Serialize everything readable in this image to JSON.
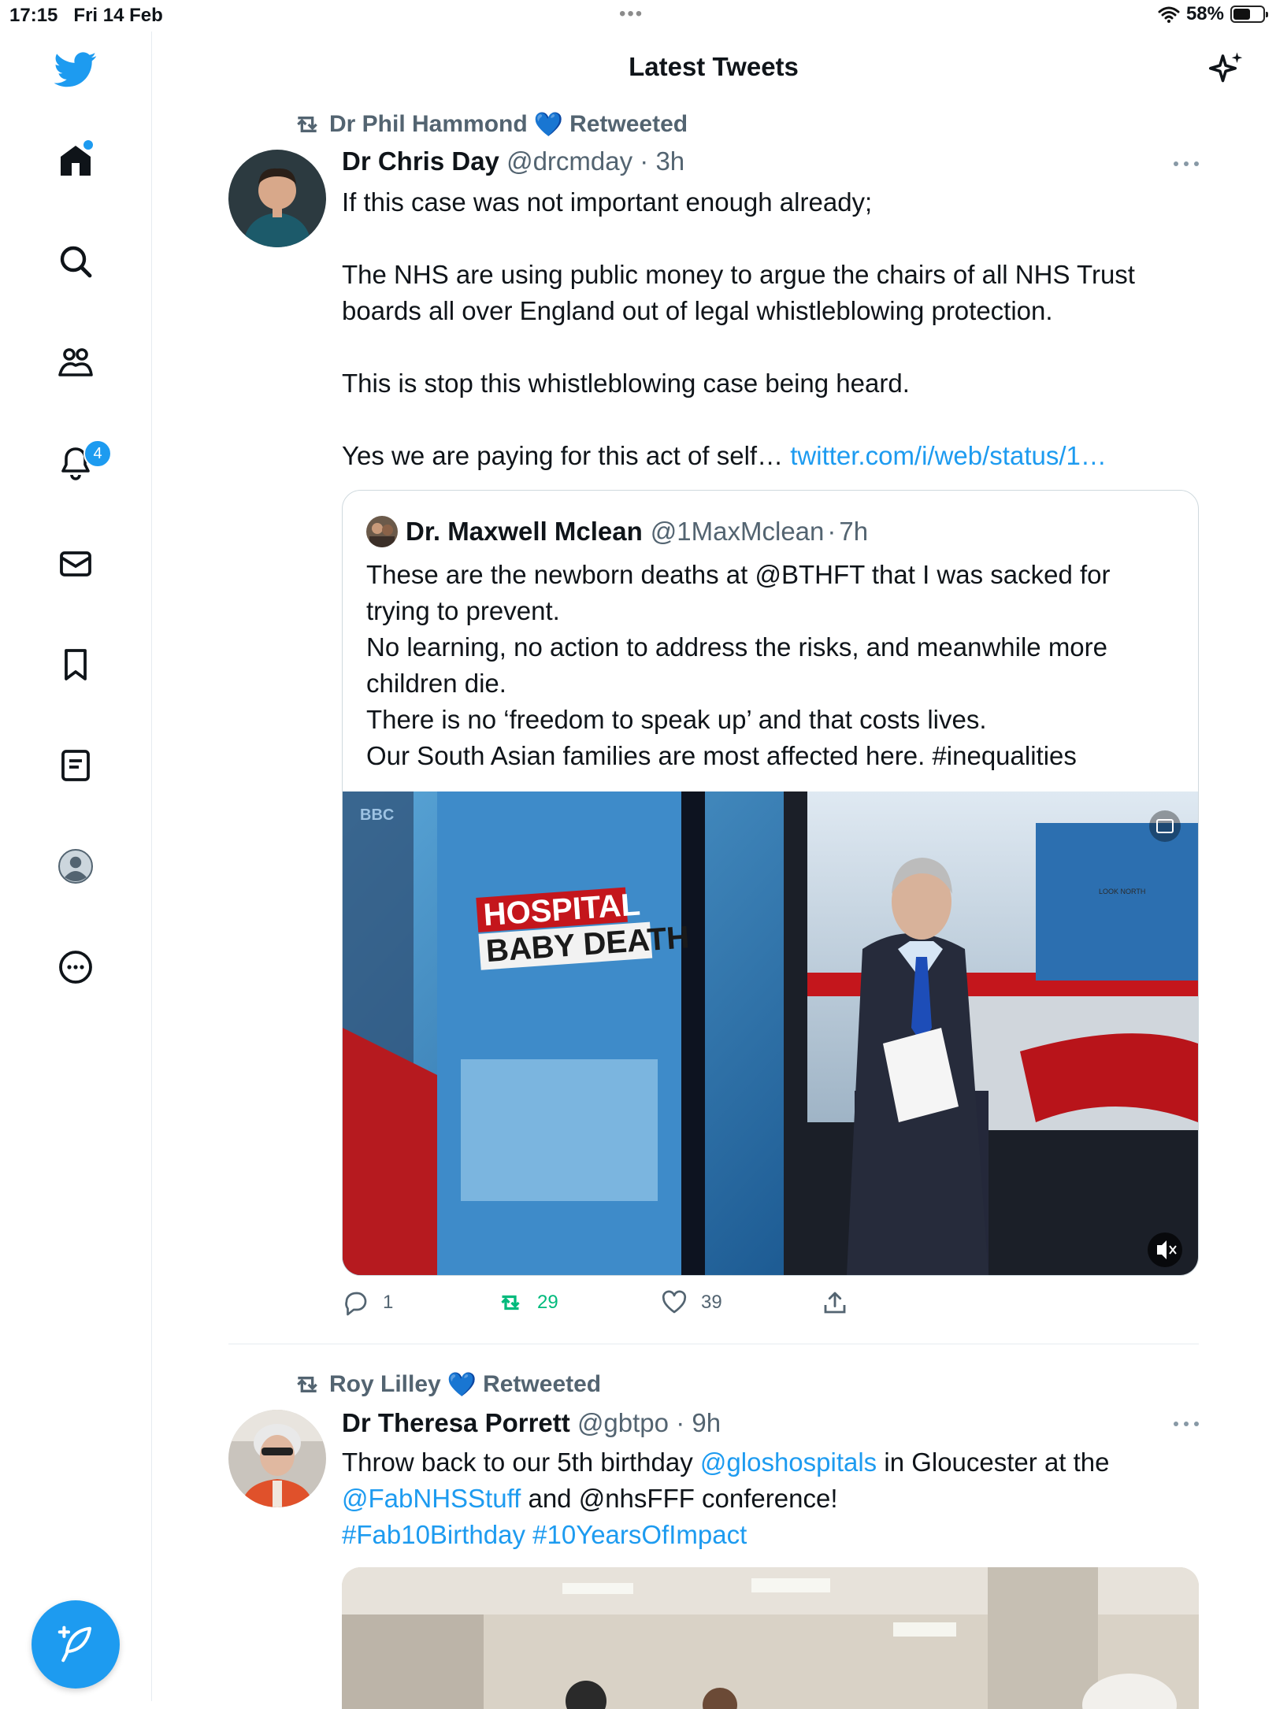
{
  "status_bar": {
    "time": "17:15",
    "date": "Fri 14 Feb",
    "battery": "58%",
    "battery_level": 0.58
  },
  "header": {
    "title": "Latest Tweets"
  },
  "sidebar": {
    "items": [
      {
        "name": "home",
        "badge": ""
      },
      {
        "name": "search",
        "badge": ""
      },
      {
        "name": "communities",
        "badge": ""
      },
      {
        "name": "notifications",
        "badge": "4"
      },
      {
        "name": "messages",
        "badge": ""
      },
      {
        "name": "bookmarks",
        "badge": ""
      },
      {
        "name": "lists",
        "badge": ""
      },
      {
        "name": "profile",
        "badge": ""
      },
      {
        "name": "more",
        "badge": ""
      }
    ]
  },
  "tweets": [
    {
      "retweeted_by": "Dr Phil Hammond",
      "retweeted_label": "Retweeted",
      "name": "Dr Chris Day",
      "handle": "@drcmday",
      "time": "3h",
      "text": [
        "If this case was not important enough already;",
        "The NHS are using public money to argue the chairs of all NHS Trust boards all over England out of legal whistleblowing protection.",
        "This is stop this whistleblowing case being heard.",
        "Yes we are paying for this act of self… "
      ],
      "link": "twitter.com/i/web/status/1…",
      "quote": {
        "name": "Dr. Maxwell Mclean",
        "handle": "@1MaxMclean",
        "time": "7h",
        "lines": [
          "These are the newborn deaths at @BTHFT that I was sacked for trying to prevent.",
          "No learning, no action to address the risks, and meanwhile more children die.",
          "There is no ‘freedom to speak up’ and that costs lives.",
          "Our South Asian families are most affected here. #inequalities"
        ],
        "media": {
          "headline_line1": "HOSPITAL",
          "headline_line2": "BABY DEATH",
          "channel_logo": "BBC",
          "corner_label": "LOOK NORTH"
        }
      },
      "stats": {
        "replies": "1",
        "retweets": "29",
        "likes": "39"
      }
    },
    {
      "retweeted_by": "Roy Lilley",
      "retweeted_label": "Retweeted",
      "name": "Dr Theresa Porrett",
      "handle": "@gbtpo",
      "time": "9h",
      "text_parts": {
        "a": "Throw back to our 5th birthday ",
        "mention1": "@gloshospitals",
        "b": " in Gloucester at the ",
        "mention2": "@FabNHSStuff",
        "c": " and @nhsFFF conference!",
        "hashtags": "#Fab10Birthday #10YearsOfImpact"
      }
    }
  ],
  "colors": {
    "accent": "#1d9bf0",
    "retweet_green": "#00ba7c",
    "secondary_text": "#536471",
    "heart_blue": "#1d9bf0"
  }
}
